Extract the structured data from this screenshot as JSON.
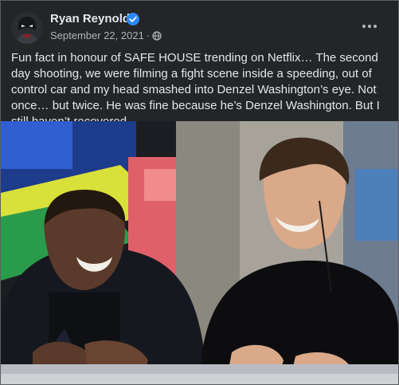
{
  "post": {
    "author": "Ryan Reynolds",
    "date": "September 22, 2021",
    "separator": "·",
    "icons": {
      "verified": "verified-badge-icon",
      "audience": "globe-icon",
      "more": "more-options-icon"
    },
    "caption": "Fun fact in honour of SAFE HOUSE trending on Netflix… The second day shooting, we were filming a fight scene inside a speeding, out of control car and my head smashed into Denzel Washington’s eye. Not once… but twice. He was fine because he’s Denzel Washington. But I still haven’t recovered.",
    "colors": {
      "card_background": "#242526",
      "primary_text": "#e4e6eb",
      "secondary_text": "#b0b3b8",
      "verified_blue": "#2d88ff"
    }
  }
}
